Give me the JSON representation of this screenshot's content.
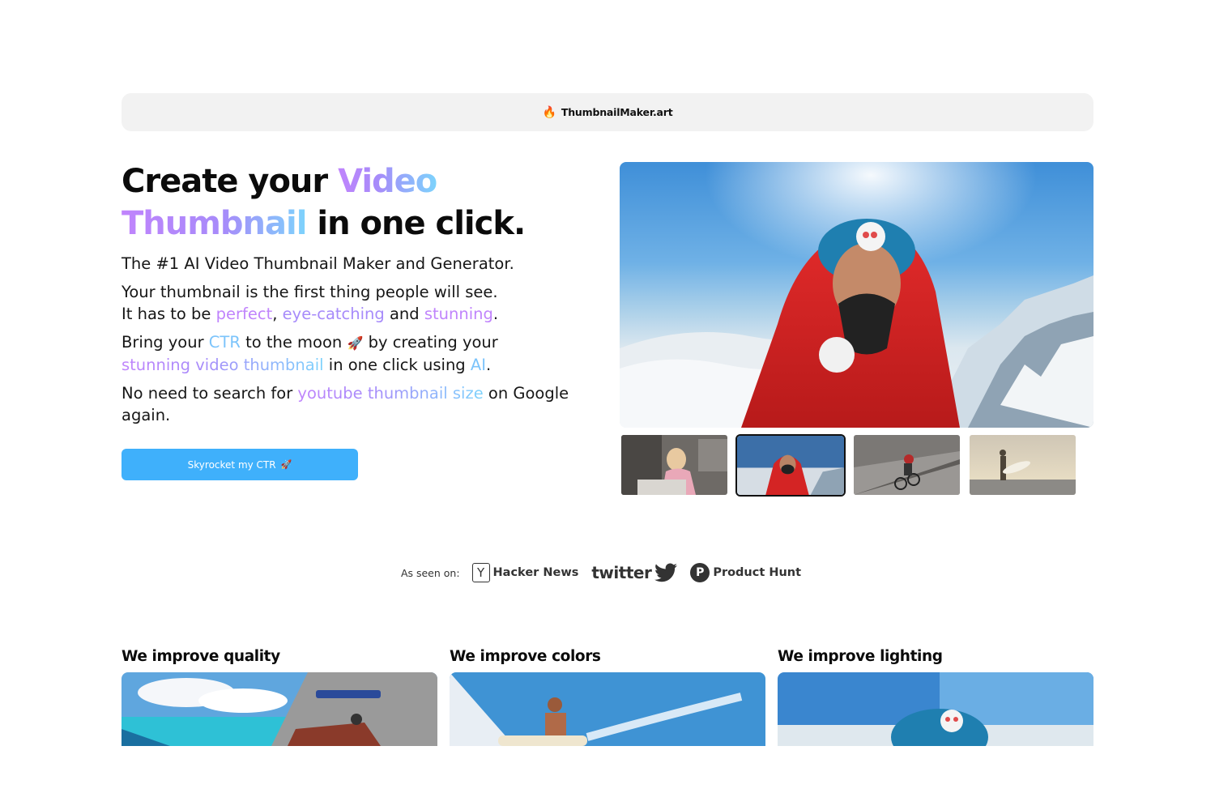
{
  "topbar": {
    "icon": "flame-icon",
    "flame_glyph": "🔥",
    "brand": "ThumbnailMaker.art"
  },
  "hero": {
    "headline": {
      "part1": "Create your ",
      "highlight1": "Video",
      "highlight2": "Thumbnail",
      "part2": " in one click."
    },
    "lead": "The #1 AI Video Thumbnail Maker and Generator.",
    "para1": {
      "line1": "Your thumbnail is the first thing people will see.",
      "line2_a": "It has to be ",
      "perfect": "perfect",
      "comma": ", ",
      "eye_catching": "eye-catching",
      "and": " and ",
      "stunning": "stunning",
      "period": "."
    },
    "para2": {
      "a": "Bring your ",
      "ctr": "CTR",
      "b": " to the moon ",
      "rocket": "🚀",
      "c": " by creating your ",
      "stunning_video_thumbnail": "stunning video thumbnail",
      "d": " in one click using ",
      "ai": "AI",
      "e": "."
    },
    "para3": {
      "a": "No need to search for ",
      "youtube_size": "youtube thumbnail size",
      "b": " on Google again."
    },
    "cta_label": "Skyrocket my CTR",
    "cta_icon": "🚀"
  },
  "gallery": {
    "selected_index": 1,
    "thumbnails": [
      "artist-desk",
      "mountaineer-selfie",
      "mountain-biker-stairs",
      "surfer-sunset"
    ]
  },
  "as_seen_on": {
    "label": "As seen on:",
    "hacker_news_mark": "Y",
    "hacker_news": "Hacker News",
    "twitter": "twitter",
    "product_hunt_mark": "P",
    "product_hunt": "Product Hunt"
  },
  "features": [
    {
      "title": "We improve quality"
    },
    {
      "title": "We improve colors"
    },
    {
      "title": "We improve lighting"
    }
  ],
  "colors": {
    "cta": "#3fb0fb",
    "accent_purple": "#c084fc",
    "accent_violet": "#a78bfa",
    "accent_blue": "#7dd3fc",
    "topbar_bg": "#f2f2f2"
  }
}
